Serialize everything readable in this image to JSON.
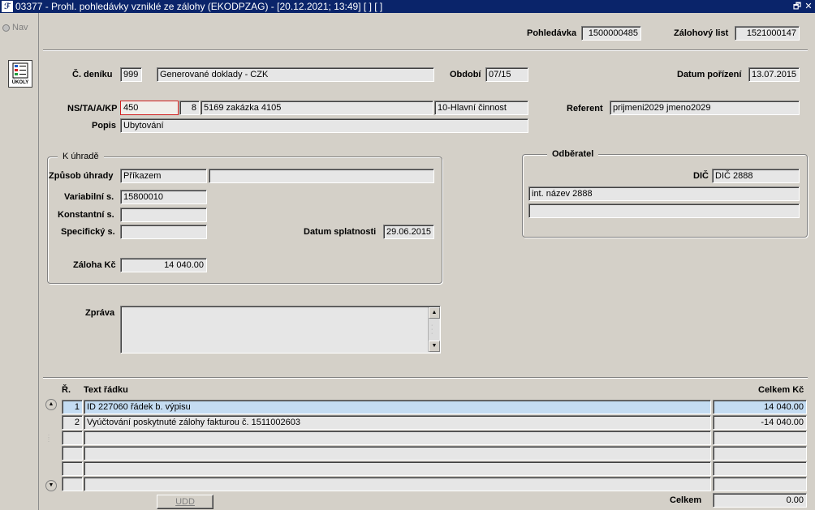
{
  "window": {
    "title": "03377 - Prohl. pohledávky vzniklé ze zálohy (EKODPZAG) - [20.12.2021; 13:49]  [ ] [ ]",
    "app_icon": "ekonom-logo-icon",
    "restore_glyph": "🗗",
    "close_glyph": "✕"
  },
  "sidebar": {
    "nav_label": "Nav",
    "tasks_label": "ÚKOLY",
    "tasks_icon": "checklist-icon"
  },
  "header": {
    "receivable_label": "Pohledávka",
    "receivable_value": "1500000485",
    "advance_sheet_label": "Zálohový list",
    "advance_sheet_value": "1521000147"
  },
  "form": {
    "journal_label": "Č. deníku",
    "journal_no": "999",
    "journal_name": "Generované doklady - CZK",
    "period_label": "Období",
    "period_value": "07/15",
    "acq_date_label": "Datum pořízení",
    "acq_date_value": "13.07.2015",
    "ns_label": "NS/TA/A/KP",
    "ns_value": "450",
    "ta_value": "8",
    "order_value": "5169 zakázka 4105",
    "activity_value": "10-Hlavní činnost",
    "referent_label": "Referent",
    "referent_value": "prijmeni2029 jmeno2029",
    "desc_label": "Popis",
    "desc_value": "Ubytování"
  },
  "payment": {
    "group_title": "K úhradě",
    "method_label": "Způsob úhrady",
    "method_value": "Příkazem",
    "method_extra": "",
    "variable_label": "Variabilní s.",
    "variable_value": "15800010",
    "constant_label": "Konstantní s.",
    "constant_value": "",
    "specific_label": "Specifický s.",
    "specific_value": "",
    "due_label": "Datum splatnosti",
    "due_value": "29.06.2015",
    "advance_label": "Záloha Kč",
    "advance_value": "14 040.00"
  },
  "customer": {
    "group_title": "Odběratel",
    "dic_label": "DIČ",
    "dic_value": "DIČ 2888",
    "name_value": "int. název 2888",
    "extra_value": ""
  },
  "message": {
    "label": "Zpráva",
    "value": ""
  },
  "lines": {
    "col_row": "Ř.",
    "col_text": "Text řádku",
    "col_total": "Celkem Kč",
    "rows": [
      {
        "no": "1",
        "text": "ID 227060 řádek b. výpisu",
        "total": "14 040.00"
      },
      {
        "no": "2",
        "text": "Vyúčtování poskytnuté zálohy fakturou č. 1511002603",
        "total": "-14 040.00"
      },
      {
        "no": "",
        "text": "",
        "total": ""
      },
      {
        "no": "",
        "text": "",
        "total": ""
      },
      {
        "no": "",
        "text": "",
        "total": ""
      },
      {
        "no": "",
        "text": "",
        "total": ""
      }
    ],
    "udd_label": "UDD",
    "sum_label": "Celkem",
    "sum_value": "0.00"
  }
}
